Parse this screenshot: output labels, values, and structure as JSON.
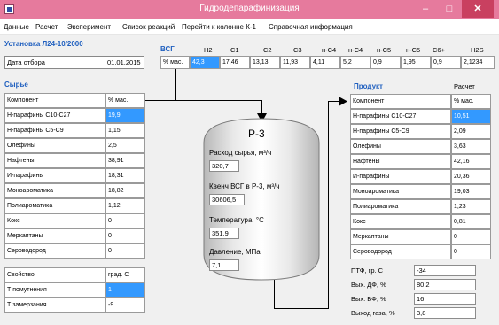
{
  "window": {
    "title": "Гидродепарафинизация",
    "min_glyph": "–",
    "max_glyph": "□",
    "close_glyph": "✕"
  },
  "menu": {
    "items": [
      "Данные",
      "Расчет",
      "Эксперимент",
      "Список реакций",
      "Перейти к колонне К-1",
      "Справочная информация"
    ]
  },
  "plant": {
    "title": "Установка Л24-10/2000",
    "date_label": "Дата отбора",
    "date_value": "01.01.2015"
  },
  "vsg": {
    "title": "ВСГ",
    "unit": "% мас.",
    "headers": [
      "H2",
      "C1",
      "C2",
      "C3",
      "н-C4",
      "н-C4",
      "н-C5",
      "н-C5",
      "C6+",
      "H2S"
    ],
    "values": [
      "42,3",
      "17,46",
      "13,13",
      "11,93",
      "4,11",
      "5,2",
      "0,9",
      "1,95",
      "0,9",
      "2,1234"
    ]
  },
  "feed": {
    "title": "Сырье",
    "header_component": "Компонент",
    "header_unit": "% мас.",
    "rows": [
      {
        "name": "Н-парафины С10-С27",
        "value": "19,9"
      },
      {
        "name": "Н-парафины С5-С9",
        "value": "1,15"
      },
      {
        "name": "Олефины",
        "value": "2,5"
      },
      {
        "name": "Нафтены",
        "value": "38,91"
      },
      {
        "name": "И-парафины",
        "value": "18,31"
      },
      {
        "name": "Моноароматика",
        "value": "18,82"
      },
      {
        "name": "Полиароматика",
        "value": "1,12"
      },
      {
        "name": "Кокс",
        "value": "0"
      },
      {
        "name": "Меркаптаны",
        "value": "0"
      },
      {
        "name": "Сероводород",
        "value": "0"
      }
    ]
  },
  "props": {
    "header_name": "Свойство",
    "header_unit": "град. С",
    "rows": [
      {
        "name": "Т помутнения",
        "value": "1"
      },
      {
        "name": "Т замерзания",
        "value": "-9"
      }
    ]
  },
  "reactor": {
    "title": "Р-3",
    "flow_label": "Расход сырья, м³/ч",
    "flow_value": "320,7",
    "quench_label": "Квенч ВСГ в Р-3, м³/ч",
    "quench_value": "30606,5",
    "temp_label": "Температура, °С",
    "temp_value": "351,9",
    "pressure_label": "Давление, МПа",
    "pressure_value": "7,1"
  },
  "product": {
    "title": "Продукт",
    "calc_label": "Расчет",
    "header_component": "Компонент",
    "header_unit": "% мас.",
    "rows": [
      {
        "name": "Н-парафины С10-С27",
        "value": "10,51"
      },
      {
        "name": "Н-парафины С5-С9",
        "value": "2,09"
      },
      {
        "name": "Олефины",
        "value": "3,63"
      },
      {
        "name": "Нафтены",
        "value": "42,16"
      },
      {
        "name": "И-парафины",
        "value": "20,36"
      },
      {
        "name": "Моноароматика",
        "value": "19,03"
      },
      {
        "name": "Полиароматика",
        "value": "1,23"
      },
      {
        "name": "Кокс",
        "value": "0,81"
      },
      {
        "name": "Меркаптаны",
        "value": "0"
      },
      {
        "name": "Сероводород",
        "value": "0"
      }
    ]
  },
  "results": [
    {
      "label": "ПТФ, гр. С",
      "value": "-34"
    },
    {
      "label": "Вых. ДФ, %",
      "value": "80,2"
    },
    {
      "label": "Вых. БФ, %",
      "value": "16"
    },
    {
      "label": "Выход газа, %",
      "value": "3,8"
    }
  ],
  "colors": {
    "titlebar": "#e67a9d",
    "accent": "#1f5fbf",
    "selection": "#3399ff"
  }
}
